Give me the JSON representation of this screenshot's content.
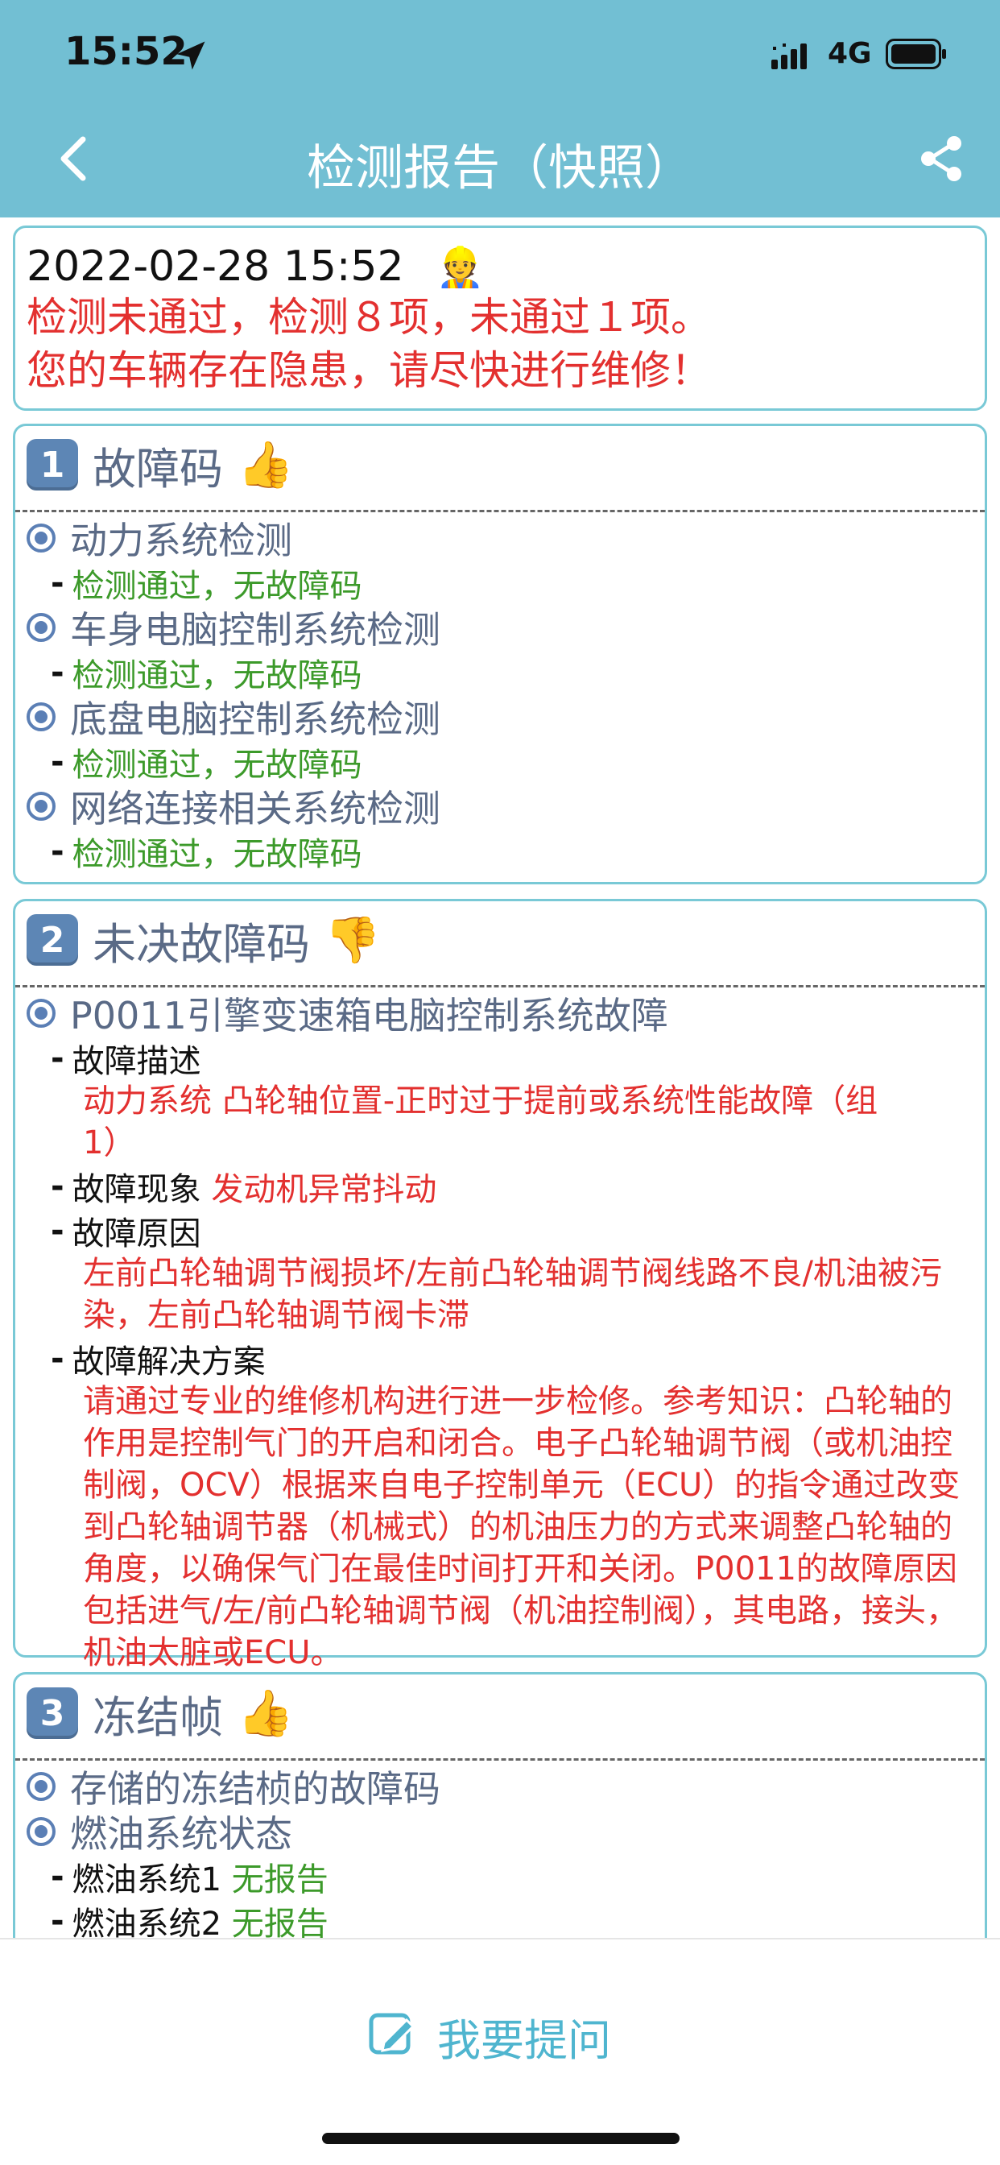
{
  "status_bar": {
    "time": "15:52",
    "network": "4G"
  },
  "nav": {
    "title": "检测报告（快照）"
  },
  "summary": {
    "datetime": "2022-02-28 15:52",
    "emoji": "👷",
    "line1": "检测未通过，检测８项，未通过１项。",
    "line2": "您的车辆存在隐患，请尽快进行维修！"
  },
  "section1": {
    "number": "1",
    "title": "故障码",
    "emoji": "👍",
    "items": [
      {
        "label": "动力系统检测",
        "result": "检测通过，无故障码"
      },
      {
        "label": "车身电脑控制系统检测",
        "result": "检测通过，无故障码"
      },
      {
        "label": "底盘电脑控制系统检测",
        "result": "检测通过，无故障码"
      },
      {
        "label": "网络连接相关系统检测",
        "result": "检测通过，无故障码"
      }
    ]
  },
  "section2": {
    "number": "2",
    "title": "未决故障码",
    "emoji": "👎",
    "item_label": "P0011引擎变速箱电脑控制系统故障",
    "desc_label": "故障描述",
    "desc_text": "动力系统 凸轮轴位置-正时过于提前或系统性能故障（组1）",
    "symptom_label": "故障现象",
    "symptom_text": "发动机异常抖动",
    "cause_label": "故障原因",
    "cause_text": "左前凸轮轴调节阀损坏/左前凸轮轴调节阀线路不良/机油被污染，左前凸轮轴调节阀卡滞",
    "solution_label": "故障解决方案",
    "solution_text": "请通过专业的维修机构进行进一步检修。参考知识：凸轮轴的作用是控制气门的开启和闭合。电子凸轮轴调节阀（或机油控制阀，OCV）根据来自电子控制单元（ECU）的指令通过改变到凸轮轴调节器（机械式）的机油压力的方式来调整凸轮轴的角度，以确保气门在最佳时间打开和关闭。P0011的故障原因包括进气/左/前凸轮轴调节阀（机油控制阀），其电路，接头，机油太脏或ECU。"
  },
  "section3": {
    "number": "3",
    "title": "冻结帧",
    "emoji": "👍",
    "item1": "存储的冻结桢的故障码",
    "item2": "燃油系统状态",
    "fuel1_label": "燃油系统1",
    "fuel1_value": "无报告",
    "fuel2_label": "燃油系统2",
    "fuel2_value": "无报告"
  },
  "bottom": {
    "ask_label": "我要提问"
  }
}
